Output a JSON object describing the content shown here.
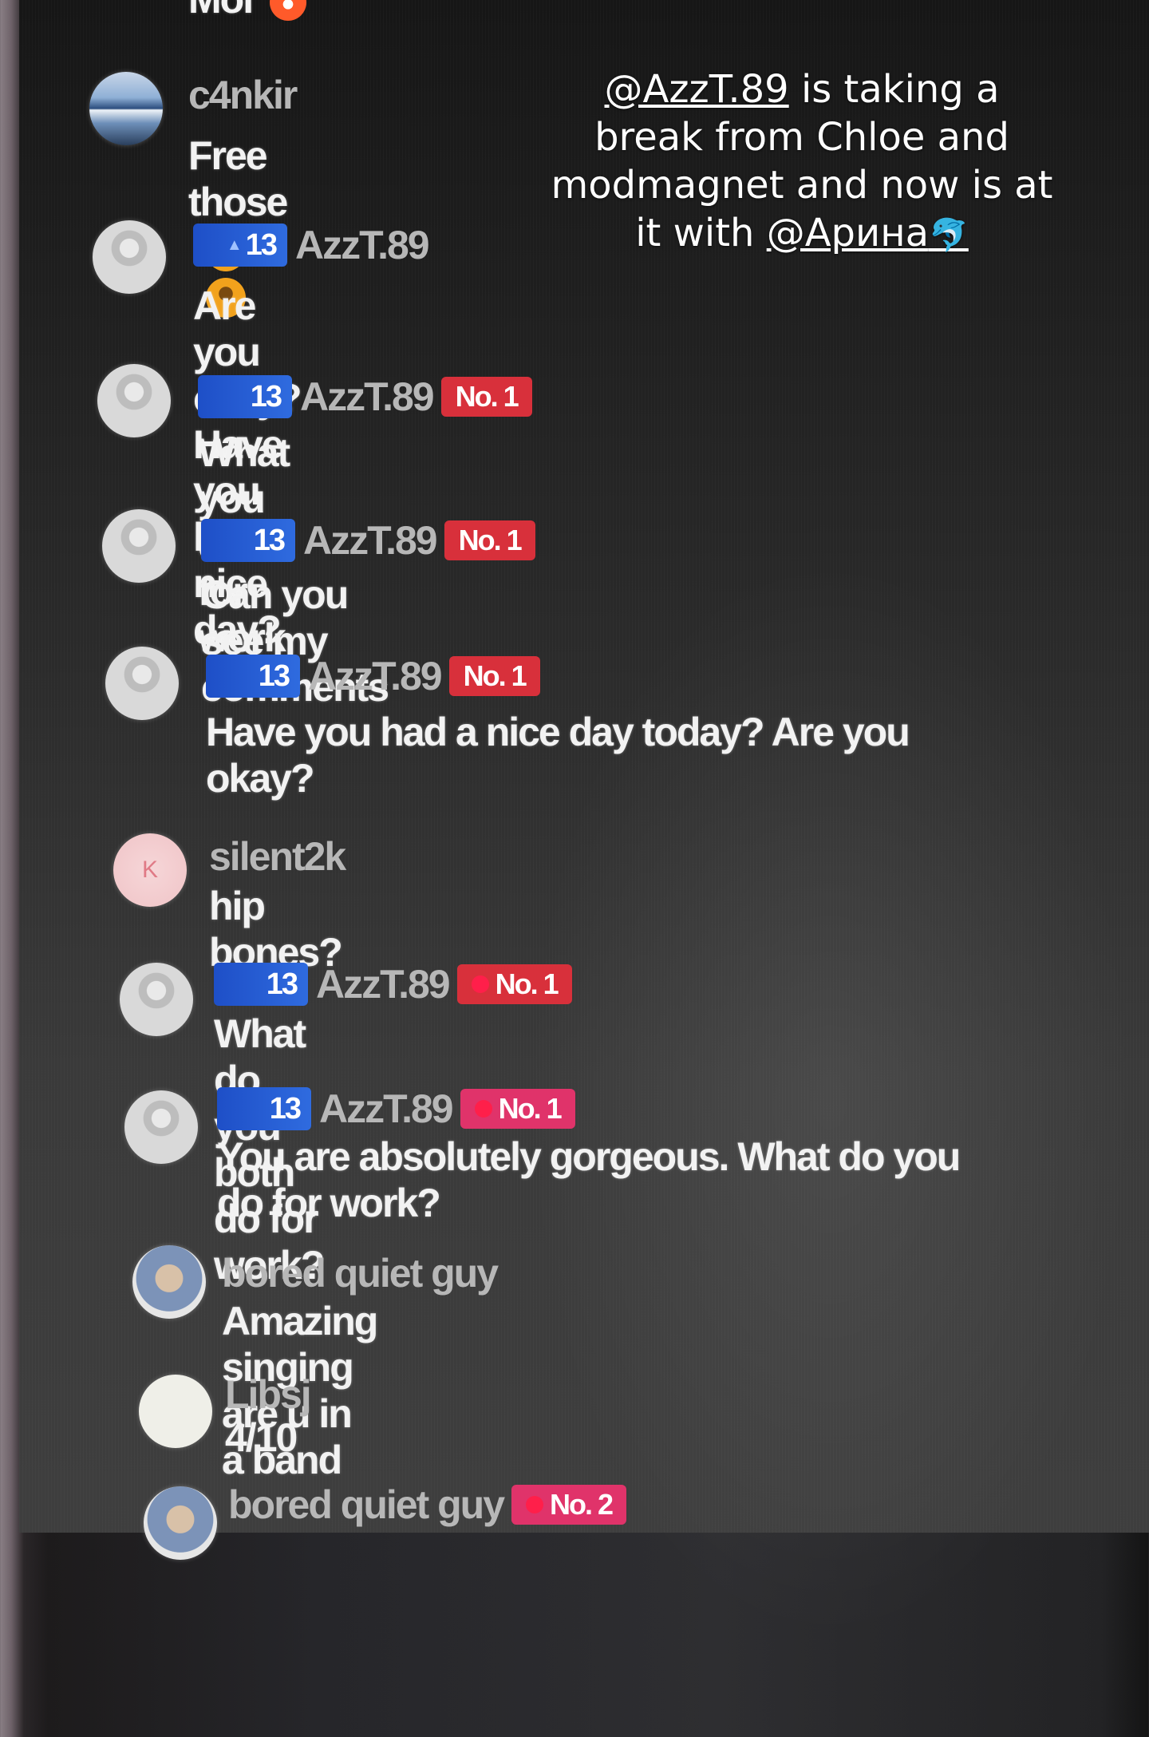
{
  "top_partial": {
    "text": "Moi"
  },
  "overlay_caption": {
    "mention1": "@AzzT.89",
    "text1": " is taking a break from Chloe and modmagnet and now is at it with ",
    "mention2": "@Арина",
    "emoji": "🐬"
  },
  "comments": [
    {
      "username": "c4nkir",
      "message": "Free those",
      "avatar": "landscape-icon"
    },
    {
      "level": "13",
      "username": "AzzT.89",
      "message": "Are you okay? Have you had a nice day?"
    },
    {
      "level": "13",
      "username": "AzzT.89",
      "rank": "No. 1",
      "message": "What you do for work"
    },
    {
      "level": "13",
      "username": "AzzT.89",
      "rank": "No. 1",
      "message": "Can you see my comments"
    },
    {
      "level": "13",
      "username": "AzzT.89",
      "rank": "No. 1",
      "message": "Have you had a nice day today? Are you okay?"
    },
    {
      "username": "silent2k",
      "message": "hip bones?",
      "avatar_letter": "K"
    },
    {
      "level": "13",
      "username": "AzzT.89",
      "rank": "No. 1",
      "message": "What do you both do for work?"
    },
    {
      "level": "13",
      "username": "AzzT.89",
      "rank": "No. 1",
      "message": "You are absolutely gorgeous. What do you do for work?"
    },
    {
      "username": "bored quiet guy",
      "message": "Amazing singing are u in a band"
    },
    {
      "username": "Libsj",
      "message": "4/10"
    },
    {
      "username": "bored quiet guy",
      "rank": "No. 2"
    }
  ],
  "colors": {
    "level_badge": "#1e4fc7",
    "rank_badge": "#d8303b",
    "rank2_badge": "#e0336a"
  }
}
